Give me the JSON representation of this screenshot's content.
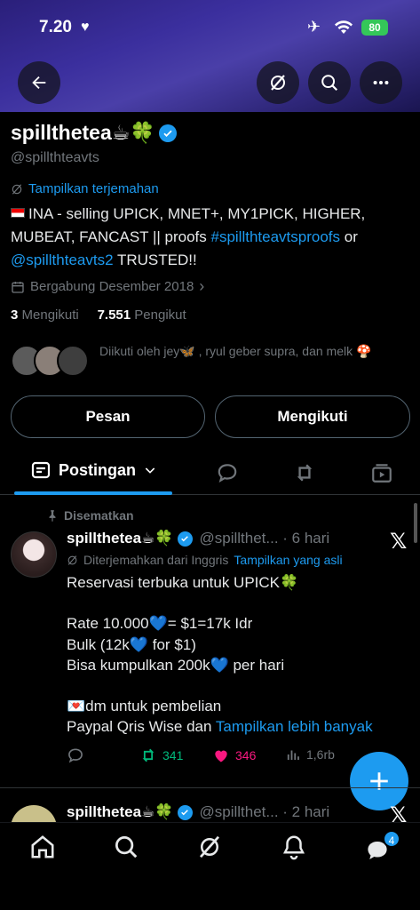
{
  "status_bar": {
    "time": "7.20",
    "battery": "80"
  },
  "profile": {
    "display_name": "spillthetea☕🍀",
    "handle": "@spillthteavts",
    "translate_label": "Tampilkan terjemahan",
    "bio_prefix": "INA - selling UPICK, MNET+, MY1PICK, HIGHER, MUBEAT, FANCAST || proofs ",
    "bio_link1": "#spillthteavtsproofs",
    "bio_mid": " or ",
    "bio_link2": "@spillthteavts2",
    "bio_suffix": " TRUSTED!!",
    "joined": "Bergabung Desember 2018",
    "following_count": "3",
    "following_label": "Mengikuti",
    "followers_count": "7.551",
    "followers_label": "Pengikut",
    "followed_by": "Diikuti oleh jey🦋 , ryul geber supra, dan melk 🍄"
  },
  "buttons": {
    "message": "Pesan",
    "following": "Mengikuti"
  },
  "tabs": {
    "posts": "Postingan"
  },
  "pinned_label": "Disematkan",
  "post": {
    "name": "spillthetea☕🍀",
    "meta": "@spillthet... · 6 hari",
    "translated_from": "Diterjemahkan dari Inggris",
    "show_original": "Tampilkan yang asli",
    "line1": "Reservasi terbuka untuk UPICK🍀",
    "line2": "Rate 10.000💙= $1=17k Idr",
    "line3": "Bulk (12k💙 for $1)",
    "line4": "Bisa kumpulkan 200k💙 per hari",
    "line5": "💌dm untuk pembelian",
    "line6": "Paypal Qris Wise dan ",
    "show_more": "Tampilkan lebih banyak",
    "retweets": "341",
    "likes": "346",
    "views": "1,6rb"
  },
  "post2": {
    "name": "spillthetea☕🍀",
    "meta": "@spillthet... · 2 hari"
  },
  "nav": {
    "notifications_badge": "4"
  },
  "colors": {
    "accent": "#1d9bf0",
    "retweet": "#00ba7c",
    "like": "#f91880",
    "background": "#000000"
  }
}
